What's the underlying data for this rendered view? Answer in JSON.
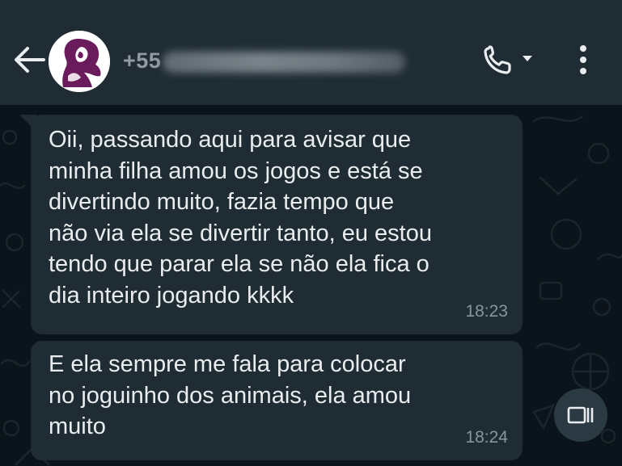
{
  "header": {
    "back_icon": "arrow-left-icon",
    "avatar_icon": "profile-silhouette-icon",
    "contact_prefix": "+55",
    "call_icon": "phone-icon",
    "call_dropdown_icon": "caret-down-icon",
    "menu_icon": "more-vertical-icon"
  },
  "messages": [
    {
      "text": "Oii, passando aqui para avisar que\nminha filha amou os jogos e está se\ndivertindo muito, fazia tempo que\nnão via ela se divertir tanto, eu estou\ntendo que parar ela se não ela fica o\ndia inteiro jogando kkkk",
      "time": "18:23"
    },
    {
      "text": "E ela sempre me fala para colocar\nno joguinho dos animais, ela amou\nmuito",
      "time": "18:24"
    }
  ],
  "fab_icon": "picture-in-picture-icon",
  "colors": {
    "header_bg": "#1f2c34",
    "chat_bg": "#0b141a",
    "bubble_bg": "#1f2c34",
    "text": "#e9edef",
    "timestamp": "#8696a0",
    "avatar_accent": "#6a1b5c"
  }
}
